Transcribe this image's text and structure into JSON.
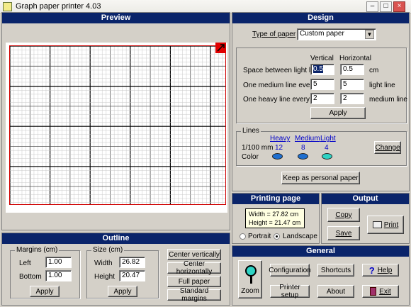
{
  "app": {
    "title": "Graph paper printer 4.03"
  },
  "window_buttons": {
    "min": "–",
    "max": "□",
    "close": "×"
  },
  "preview": {
    "title": "Preview"
  },
  "design": {
    "title": "Design",
    "type_label": "Type of paper",
    "type_value": "Custom paper",
    "col_vertical": "Vertical",
    "col_horizontal": "Horizontal",
    "rows": [
      {
        "label": "Space between light lines",
        "vertical": "0.5",
        "horizontal": "0.5",
        "unit": "cm"
      },
      {
        "label": "One medium line every",
        "vertical": "5",
        "horizontal": "5",
        "unit": "light line"
      },
      {
        "label": "One heavy line every",
        "vertical": "2",
        "horizontal": "2",
        "unit": "medium line"
      }
    ],
    "apply": "Apply",
    "lines": {
      "title": "Lines",
      "heavy": "Heavy",
      "medium": "Medium",
      "light": "Light",
      "row_label": "1/100 mm",
      "heavy_val": "12",
      "medium_val": "8",
      "light_val": "4",
      "color_label": "Color",
      "change": "Change",
      "colors": {
        "heavy": "#1e6fd0",
        "medium": "#1e6fd0",
        "light": "#2fd3c4"
      }
    },
    "keep": "Keep as personal paper"
  },
  "printing": {
    "title": "Printing page",
    "width": "Width = 27.82 cm",
    "height": "Height = 21.47 cm",
    "portrait": "Portrait",
    "landscape": "Landscape",
    "selected": "landscape"
  },
  "output": {
    "title": "Output",
    "copy": "Copy",
    "save": "Save",
    "print": "Print"
  },
  "outline": {
    "title": "Outline",
    "margins_title": "Margins (cm)",
    "left_label": "Left",
    "left_value": "1.00",
    "bottom_label": "Bottom",
    "bottom_value": "1.00",
    "apply": "Apply",
    "size_title": "Size (cm)",
    "width_label": "Width",
    "width_value": "26.82",
    "height_label": "Height",
    "height_value": "20.47",
    "size_apply": "Apply",
    "center_v": "Center vertically",
    "center_h": "Center horizontally",
    "full": "Full paper",
    "standard": "Standard margins"
  },
  "general": {
    "title": "General",
    "zoom": "Zoom",
    "configuration": "Configuration",
    "printer_setup": "Printer setup",
    "shortcuts": "Shortcuts",
    "about": "About",
    "help": "Help",
    "exit": "Exit"
  }
}
